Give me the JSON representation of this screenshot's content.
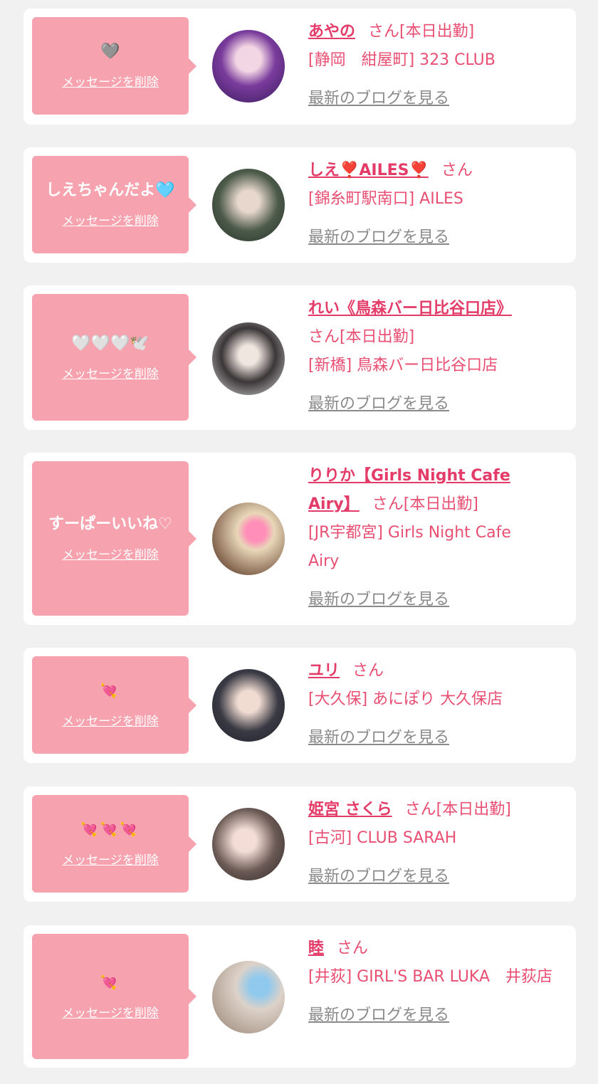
{
  "delete_label": "メッセージを削除",
  "blog_label": "最新のブログを見る",
  "cards": [
    {
      "message": "🩶",
      "cast_name": "あやの",
      "honorific": "さん[本日出勤]",
      "shop": "[静岡　紺屋町] 323 CLUB"
    },
    {
      "message": "しえちゃんだよ🩵",
      "cast_name": "しえ❣️AILES❣️",
      "honorific": "さん",
      "shop": "[錦糸町駅南口] AILES"
    },
    {
      "message": "🤍🤍🤍🕊️",
      "cast_name": "れい《鳥森バー日比谷口店》",
      "honorific": "さん[本日出勤]",
      "shop": "[新橋] 鳥森バー日比谷口店"
    },
    {
      "message": "すーぱーいいね♡",
      "cast_name": "りりか【Girls Night Cafe Airy】",
      "honorific": "さん[本日出勤]",
      "shop": "[JR宇都宮] Girls Night Cafe Airy"
    },
    {
      "message": "💘",
      "cast_name": "ユリ",
      "honorific": "さん",
      "shop": "[大久保] あにぽり 大久保店"
    },
    {
      "message": "💘💘💘",
      "cast_name": "姫宮 さくら",
      "honorific": "さん[本日出勤]",
      "shop": "[古河] CLUB SARAH"
    },
    {
      "message": "💘",
      "cast_name": "睦",
      "honorific": "さん",
      "shop": "[井荻] GIRL'S BAR LUKA　井荻店"
    }
  ]
}
